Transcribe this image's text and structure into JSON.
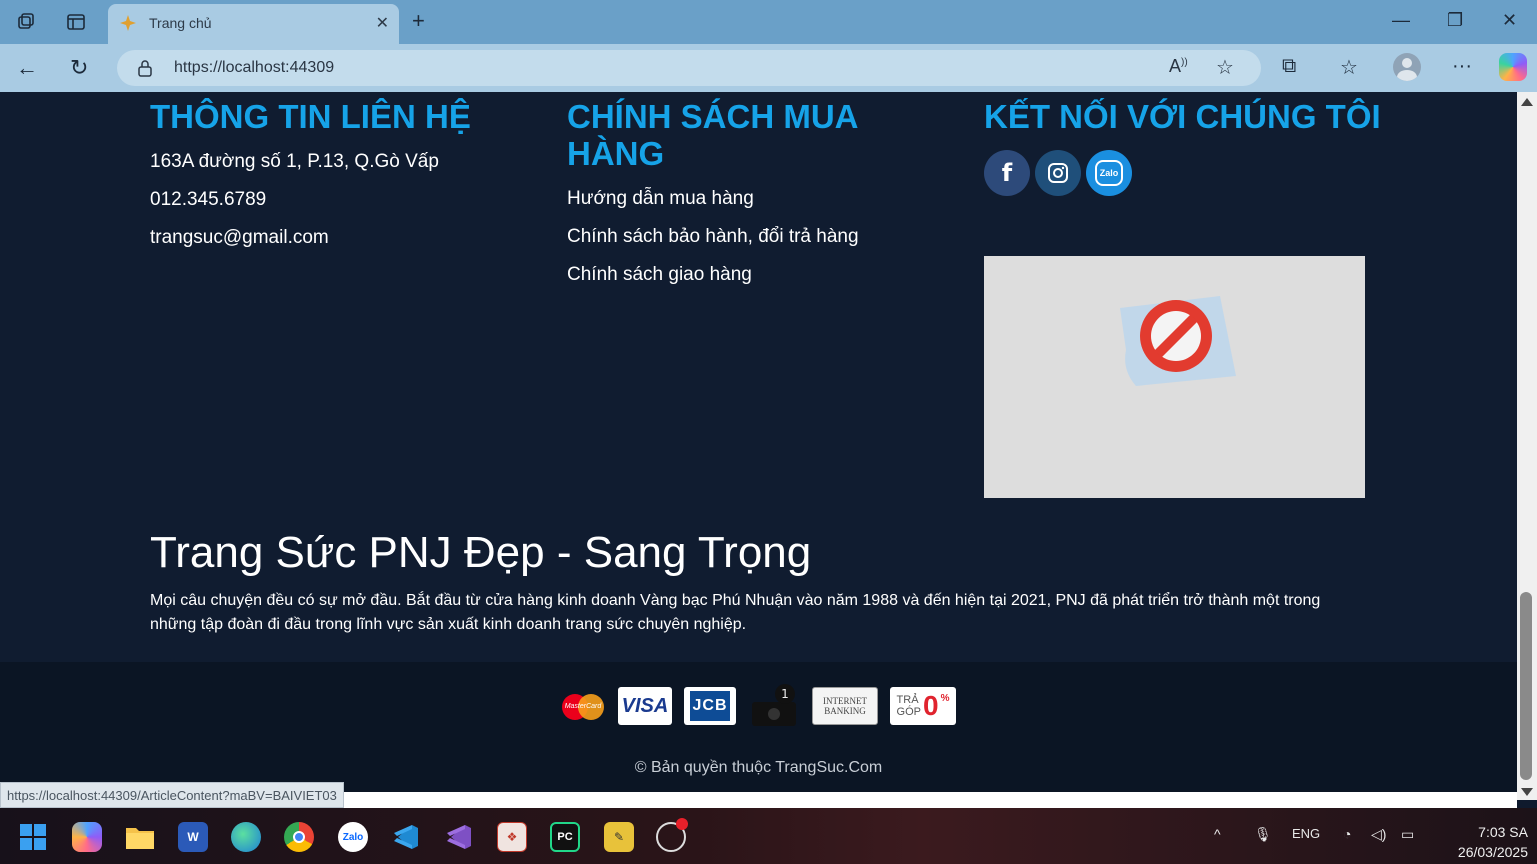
{
  "browser": {
    "tab_title": "Trang chủ",
    "url": "https://localhost:44309",
    "status_url": "https://localhost:44309/ArticleContent?maBV=BAIVIET03"
  },
  "footer": {
    "contact": {
      "heading": "THÔNG TIN LIÊN HỆ",
      "address": "163A đường số 1, P.13, Q.Gò Vấp",
      "phone": "012.345.6789",
      "email": "trangsuc@gmail.com"
    },
    "policy": {
      "heading": "CHÍNH SÁCH MUA HÀNG",
      "items": [
        "Hướng dẫn mua hàng",
        "Chính sách bảo hành, đổi trả hàng",
        "Chính sách giao hàng"
      ]
    },
    "connect": {
      "heading": "KẾT NỐI VỚI CHÚNG TÔI",
      "social": [
        "facebook-icon",
        "instagram-icon",
        "zalo-icon"
      ],
      "zalo_label": "Zalo"
    },
    "brand_title": "Trang Sức PNJ Đẹp - Sang Trọng",
    "brand_desc": "Mọi câu chuyện đều có sự mở đầu. Bắt đầu từ cửa hàng kinh doanh Vàng bạc Phú Nhuận vào năm 1988 và đến hiện tại 2021, PNJ đã phát triển trở thành một trong những tập đoàn đi đầu trong lĩnh vực sản xuất kinh doanh trang sức chuyên nghiệp.",
    "payments": {
      "mastercard": "MasterCard",
      "visa": "VISA",
      "jcb": "JCB",
      "internet_banking_1": "INTERNET",
      "internet_banking_2": "BANKING",
      "tra": "TRẢ",
      "gop": "GÓP",
      "zero": "0",
      "percent": "%"
    },
    "copyright": "© Bản quyền thuộc TrangSuc.Com"
  },
  "taskbar": {
    "zalo_label": "Zalo",
    "lang": "ENG",
    "time": "7:03 SA",
    "date": "26/03/2025"
  },
  "colors": {
    "accent": "#16a3e8",
    "footer_bg": "#101c30",
    "browser_frame": "#6aa0c8"
  }
}
